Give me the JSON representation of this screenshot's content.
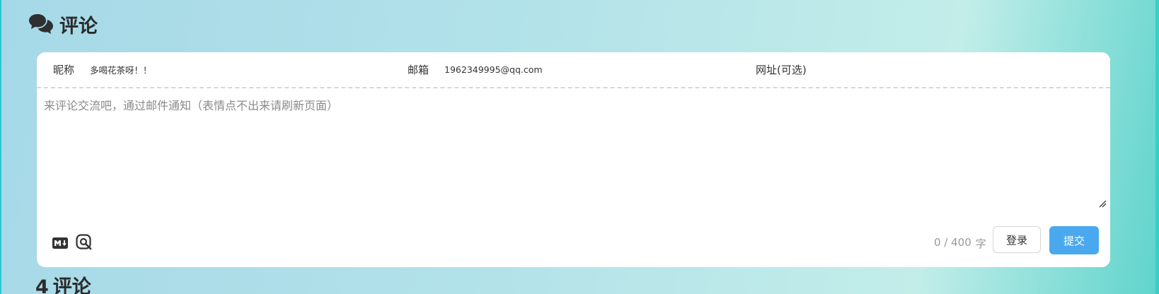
{
  "section": {
    "title": "评论",
    "icon": "comments-icon"
  },
  "form": {
    "nickname_label": "昵称",
    "nickname_value": "多喝花茶呀！！",
    "email_label": "邮箱",
    "email_value": "1962349995@qq.com",
    "website_label": "网址(可选)",
    "website_value": "",
    "editor_placeholder": "来评论交流吧，通过邮件通知（表情点不出来请刷新页面）"
  },
  "footer": {
    "markdown_icon": "markdown-icon",
    "preview_icon": "preview-icon",
    "word_count": "0 / 400",
    "word_unit": "字",
    "login_label": "登录",
    "submit_label": "提交"
  },
  "comments": {
    "count": "4",
    "label": "评论"
  },
  "colors": {
    "accent": "#4aa9ee",
    "background_left": "#a6d9e8",
    "background_right": "#5fd4cc"
  }
}
